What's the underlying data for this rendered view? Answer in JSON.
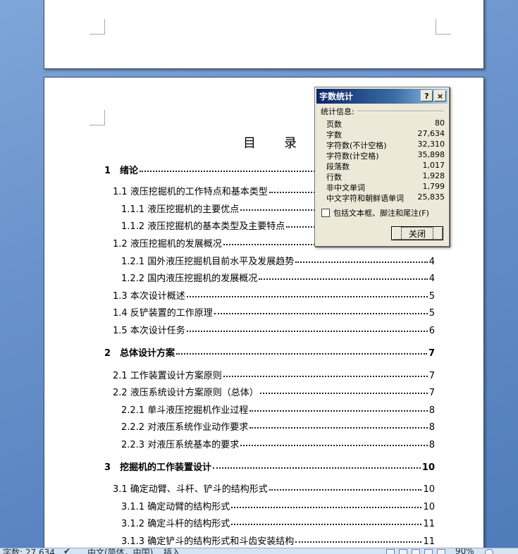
{
  "document": {
    "toc_title_chars": [
      "目",
      "录"
    ],
    "toc": [
      {
        "label": "1　绪论",
        "page": "",
        "level": 0
      },
      {
        "label": "1.1 液压挖掘机的工作特点和基本类型",
        "page": "",
        "level": 1
      },
      {
        "label": "1.1.1 液压挖掘机的主要优点",
        "page": "",
        "level": 2
      },
      {
        "label": "1.1.2 液压挖掘机的基本类型及主要特点",
        "page": "",
        "level": 2
      },
      {
        "label": "1.2 液压挖掘机的发展概况",
        "page": "",
        "level": 1
      },
      {
        "label": "1.2.1 国外液压挖掘机目前水平及发展趋势",
        "page": "4",
        "level": 2
      },
      {
        "label": "1.2.2 国内液压挖掘机的发展概况",
        "page": "4",
        "level": 2
      },
      {
        "label": "1.3 本次设计概述",
        "page": "5",
        "level": 1
      },
      {
        "label": "1.4 反铲装置的工作原理",
        "page": "5",
        "level": 1
      },
      {
        "label": "1.5 本次设计任务",
        "page": "6",
        "level": 1
      },
      {
        "label": "2　总体设计方案",
        "page": "7",
        "level": 0
      },
      {
        "label": "2.1 工作装置设计方案原则",
        "page": "7",
        "level": 1
      },
      {
        "label": "2.2 液压系统设计方案原则（总体）",
        "page": "7",
        "level": 1
      },
      {
        "label": "2.2.1 单斗液压挖掘机作业过程",
        "page": "8",
        "level": 2
      },
      {
        "label": "2.2.2 对液压系统作业动作要求",
        "page": "8",
        "level": 2
      },
      {
        "label": "2.2.3 对液压系统基本的要求",
        "page": "8",
        "level": 2
      },
      {
        "label": "3　挖掘机的工作装置设计",
        "page": "10",
        "level": 0
      },
      {
        "label": "3.1 确定动臂、斗杆、铲斗的结构形式",
        "page": "10",
        "level": 1
      },
      {
        "label": "3.1.1 确定动臂的结构形式",
        "page": "10",
        "level": 2
      },
      {
        "label": "3.1.2 确定斗杆的结构形式",
        "page": "11",
        "level": 2
      },
      {
        "label": "3.1.3 确定铲斗的结构形式和斗齿安装结构",
        "page": "11",
        "level": 2
      }
    ]
  },
  "dialog": {
    "title": "字数统计",
    "help_label": "?",
    "close_label": "×",
    "section_label": "统计信息:",
    "stats": [
      {
        "name": "页数",
        "value": "80"
      },
      {
        "name": "字数",
        "value": "27,634"
      },
      {
        "name": "字符数(不计空格)",
        "value": "32,310"
      },
      {
        "name": "字符数(计空格)",
        "value": "35,898"
      },
      {
        "name": "段落数",
        "value": "1,017"
      },
      {
        "name": "行数",
        "value": "1,928"
      },
      {
        "name": "非中文单词",
        "value": "1,799"
      },
      {
        "name": "中文字符和朝鲜语单词",
        "value": "25,835"
      }
    ],
    "checkbox_label": "包括文本框、脚注和尾注(F)",
    "checkbox_checked": false,
    "button_label": "关闭"
  },
  "statusbar": {
    "word_count": "字数: 27,634",
    "language": "中文(简体，中国)",
    "mode": "插入",
    "zoom": "90%"
  }
}
